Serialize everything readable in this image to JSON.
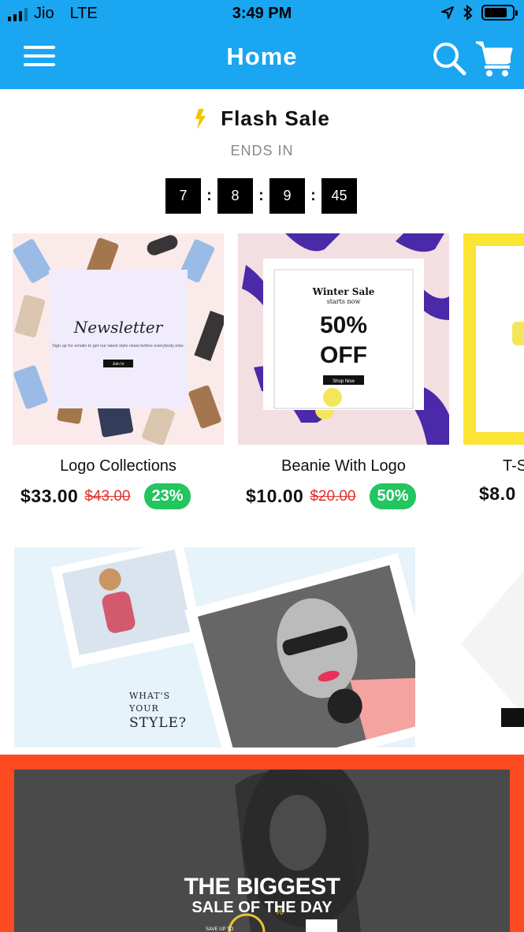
{
  "status_bar": {
    "carrier": "Jio",
    "network": "LTE",
    "time": "3:49 PM"
  },
  "app_bar": {
    "title": "Home",
    "color": "#1aa6f0"
  },
  "flash_sale": {
    "title": "Flash Sale",
    "ends_label": "ENDS IN",
    "timer": [
      "7",
      "8",
      "9",
      "45"
    ],
    "separator": ":"
  },
  "products": [
    {
      "name": "Logo Collections",
      "price": "$33.00",
      "old_price": "$43.00",
      "discount": "23%",
      "image_text": {
        "heading": "Newsletter",
        "body": "Sign up for emails to get our latest style news before everybody else.",
        "button": "Join In"
      }
    },
    {
      "name": "Beanie With Logo",
      "price": "$10.00",
      "old_price": "$20.00",
      "discount": "50%",
      "image_text": {
        "line1": "Winter Sale",
        "line2": "starts now",
        "big1": "50%",
        "big2": "OFF",
        "button": "Shop Now"
      }
    },
    {
      "name": "T-S",
      "price": "$8.0"
    }
  ],
  "style_banner": {
    "line1": "WHAT'S",
    "line2": "YOUR",
    "line3": "STYLE?"
  },
  "promo_banner": {
    "line1": "THE BIGGEST",
    "line2": "SALE OF THE DAY",
    "small": "SAVE UP TO",
    "percent_sign": "%"
  },
  "colors": {
    "accent": "#1aa6f0",
    "sale_red": "#e0312b",
    "badge_green": "#22c55e",
    "promo_orange": "#fd4a21"
  }
}
